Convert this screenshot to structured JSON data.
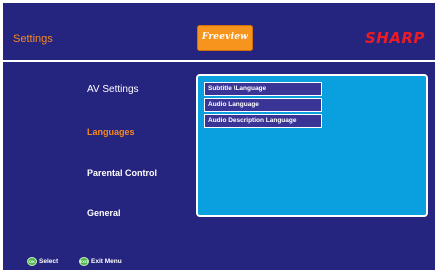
{
  "header": {
    "title": "Settings",
    "logo_text": "Freeview",
    "brand": "SHARP"
  },
  "menu": {
    "items": [
      {
        "label": "AV Settings",
        "active": false
      },
      {
        "label": "Languages",
        "active": true
      },
      {
        "label": "Parental Control",
        "active": false
      },
      {
        "label": "General",
        "active": false
      }
    ]
  },
  "languages_panel": {
    "options": [
      {
        "label": "Subtitle \\Language"
      },
      {
        "label": "Audio Language"
      },
      {
        "label": "Audio Description Language"
      }
    ]
  },
  "footer": {
    "hints": [
      {
        "icon": "ok-button-icon",
        "button_text": "OK",
        "label": "Select"
      },
      {
        "icon": "exit-button-icon",
        "button_text": "EXIT",
        "label": "Exit Menu"
      }
    ]
  },
  "colors": {
    "background": "#25247f",
    "accent": "#f58a1f",
    "panel": "#0aa0df",
    "brand": "#ed1c24",
    "button": "#4cb848"
  }
}
